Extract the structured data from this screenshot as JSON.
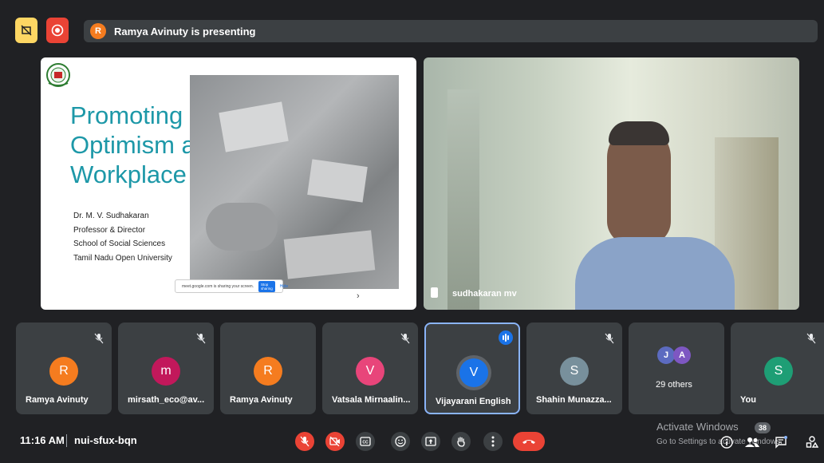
{
  "topbar": {
    "presenter_initial": "R",
    "presenting_text": "Ramya Avinuty is presenting"
  },
  "slide": {
    "title_lines": [
      "Promoting",
      "Optimism at",
      "Workplace"
    ],
    "author_lines": [
      "Dr. M. V. Sudhakaran",
      "Professor & Director",
      "School of Social Sciences",
      "Tamil Nadu Open University"
    ],
    "share_message": "meet.google.com is sharing your screen.",
    "stop_sharing": "Stop sharing",
    "hide": "Hide"
  },
  "speaker": {
    "name": "sudhakaran mv"
  },
  "tiles": [
    {
      "initial": "R",
      "name": "Ramya Avinuty",
      "color": "#f57c1f"
    },
    {
      "initial": "m",
      "name": "mirsath_eco@av...",
      "color": "#c2185b"
    },
    {
      "initial": "R",
      "name": "Ramya Avinuty",
      "color": "#f57c1f"
    },
    {
      "initial": "V",
      "name": "Vatsala Mirnaalin...",
      "color": "#e8457a"
    },
    {
      "initial": "V",
      "name": "Vijayarani English",
      "color": "#1a73e8"
    },
    {
      "initial": "S",
      "name": "Shahin Munazza...",
      "color": "#78909c"
    },
    {
      "initials": [
        "J",
        "A"
      ],
      "name": "29 others",
      "colors": [
        "#5c6bc0",
        "#7e57c2"
      ]
    },
    {
      "initial": "S",
      "name": "You",
      "color": "#1e9e75"
    }
  ],
  "bottombar": {
    "time": "11:16 AM",
    "meeting_code": "nui-sfux-bqn",
    "activate_title": "Activate Windows",
    "activate_sub": "Go to Settings to activate Windows.",
    "participants_count": "38"
  }
}
